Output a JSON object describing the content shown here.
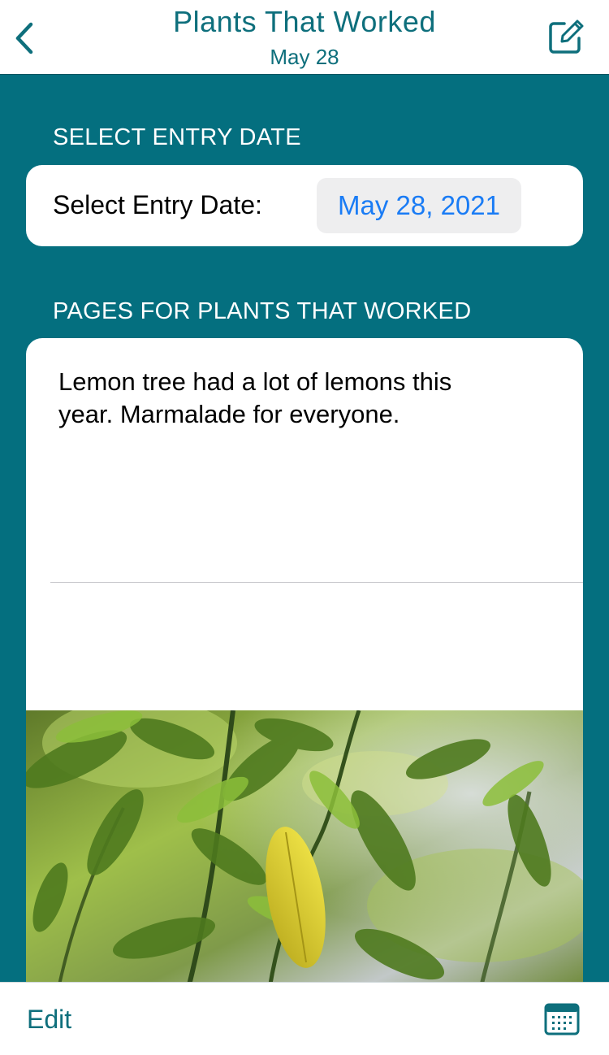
{
  "nav": {
    "title": "Plants That Worked",
    "subtitle": "May 28",
    "back_icon": "chevron-left-icon",
    "compose_icon": "compose-icon"
  },
  "entry_date_section": {
    "header": "SELECT ENTRY DATE",
    "label": "Select Entry Date:",
    "value": "May 28, 2021"
  },
  "pages_section": {
    "header": "PAGES FOR PLANTS THAT WORKED",
    "entry_text": "Lemon tree had a lot of lemons this year. Marmalade for everyone.",
    "photo_subject": "lemon tree leaves photo"
  },
  "toolbar": {
    "edit_label": "Edit",
    "calendar_icon": "calendar-icon"
  },
  "colors": {
    "accent": "#0e6f7c",
    "background": "#046f7f",
    "date_value": "#1a7cf5"
  }
}
